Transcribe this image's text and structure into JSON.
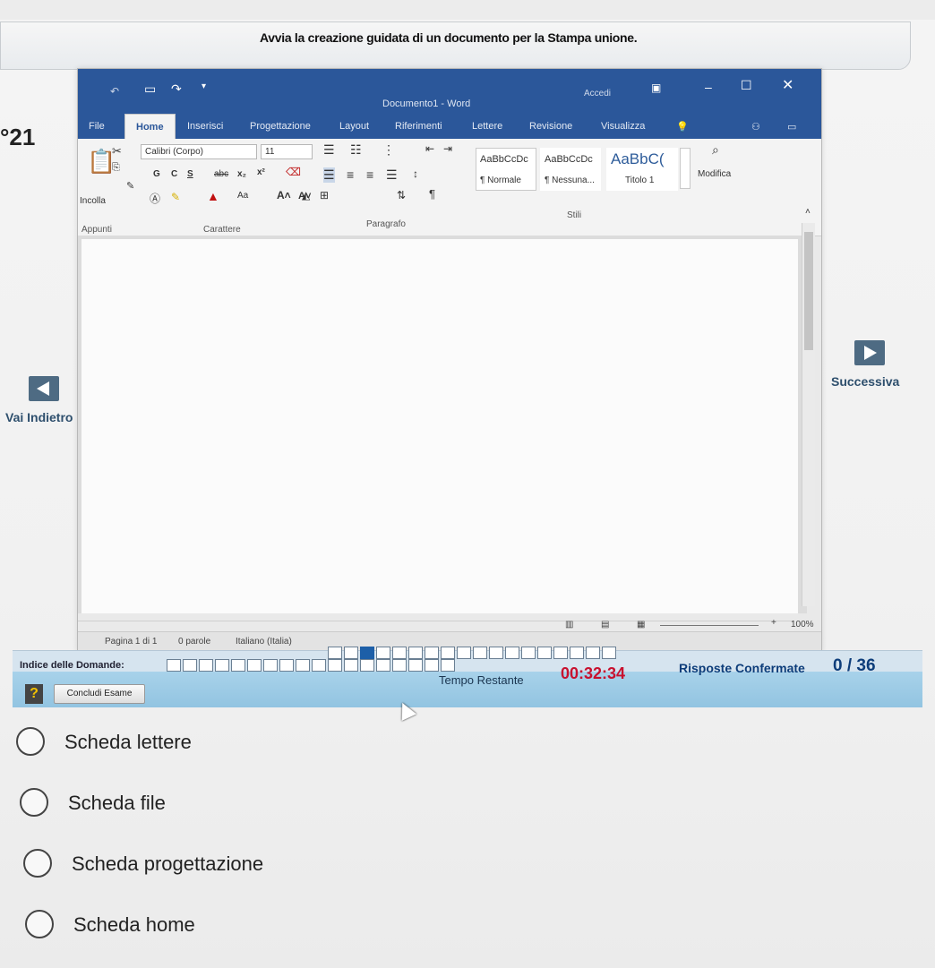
{
  "banner": {
    "text": "Avvia la creazione guidata di un documento per la Stampa unione."
  },
  "question_number": "°21",
  "word": {
    "title": "Documento1 - Word",
    "user": "Accedi",
    "tabs": [
      "File",
      "Home",
      "Inserisci",
      "Progettazione",
      "Layout",
      "Riferimenti",
      "Lettere",
      "Revisione",
      "Visualizza"
    ],
    "active_tab": "Home",
    "ribbon": {
      "paste_label": "Incolla",
      "font_name": "Calibri (Corpo)",
      "font_size": "11",
      "format_letters": [
        "G",
        "C",
        "S",
        "abc",
        "x₂",
        "x²"
      ],
      "font_extra": "Aa",
      "styles": [
        {
          "preview": "AaBbCcDc",
          "name": "¶ Normale"
        },
        {
          "preview": "AaBbCcDc",
          "name": "¶ Nessuna..."
        },
        {
          "preview": "AaBbC(",
          "name": "Titolo 1"
        }
      ],
      "modify_label": "Modifica",
      "groups": {
        "clipboard": "Appunti",
        "font": "Carattere",
        "paragraph": "Paragrafo",
        "styles": "Stili"
      }
    },
    "status": {
      "page": "Pagina 1 di 1",
      "words": "0 parole",
      "language": "Italiano (Italia)",
      "zoom": "100%"
    }
  },
  "nav": {
    "prev_label": "Vai Indietro",
    "next_label": "Successiva"
  },
  "exam": {
    "index_label": "Indice delle Domande:",
    "finish_label": "Concludi Esame",
    "help_label": "?",
    "time_label": "Tempo Restante",
    "time_value": "00:32:34",
    "confirmed_label": "Risposte Confermate",
    "confirmed_value": "0 / 36",
    "total_cells": 36,
    "current_cell": 21
  },
  "answers": [
    "Scheda lettere",
    "Scheda file",
    "Scheda progettazione",
    "Scheda home"
  ]
}
